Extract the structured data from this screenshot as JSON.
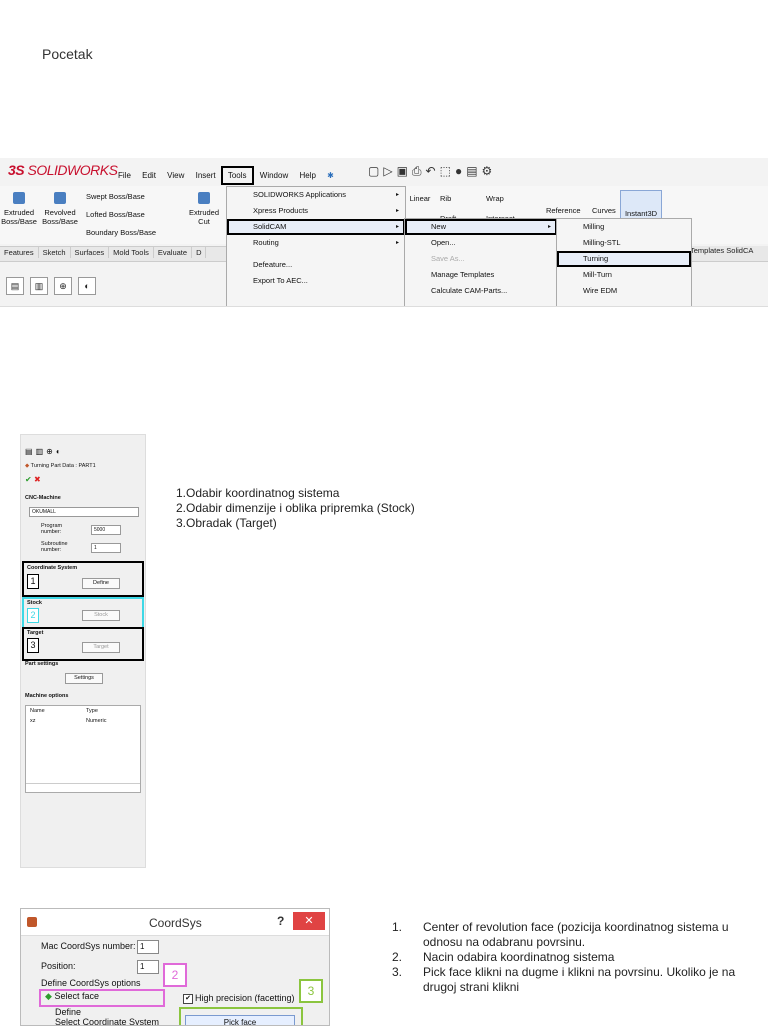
{
  "page_title": "Pocetak",
  "solidworks": {
    "logo": "SOLIDWORKS",
    "menubar": [
      "File",
      "Edit",
      "View",
      "Insert",
      "Tools",
      "Window",
      "Help"
    ],
    "ribbon": {
      "extruded": "Extruded Boss/Base",
      "revolved": "Revolved Boss/Base",
      "swept": "Swept Boss/Base",
      "lofted": "Lofted Boss/Base",
      "boundary": "Boundary Boss/Base",
      "extruded_cut": "Extruded Cut",
      "linear": "Linear",
      "rib": "Rib",
      "draft": "Draft",
      "wrap": "Wrap",
      "intersect": "Intersect",
      "reference": "Reference",
      "curves": "Curves",
      "instant3d": "Instant3D"
    },
    "tabs": [
      "Features",
      "Sketch",
      "Surfaces",
      "Mold Tools",
      "Evaluate",
      "D"
    ],
    "right_tabs": "Templates  SolidCA",
    "tools_menu": [
      {
        "label": "SOLIDWORKS Applications",
        "arrow": "▸"
      },
      {
        "label": "Xpress Products",
        "arrow": "▸"
      },
      {
        "label": "SolidCAM",
        "arrow": "▸"
      },
      {
        "label": "Routing",
        "arrow": "▸"
      },
      {
        "label": "Defeature...",
        "arrow": ""
      },
      {
        "label": "Export To AEC...",
        "arrow": ""
      }
    ],
    "solidcam_menu": [
      {
        "label": "New",
        "arrow": "▸"
      },
      {
        "label": "Open...",
        "arrow": ""
      },
      {
        "label": "Save As...",
        "arrow": ""
      },
      {
        "label": "Manage Templates",
        "arrow": ""
      },
      {
        "label": "Calculate CAM-Parts...",
        "arrow": ""
      }
    ],
    "new_menu": [
      "Milling",
      "Milling-STL",
      "Turning",
      "Mill-Turn",
      "Wire EDM"
    ]
  },
  "turning_panel": {
    "title": "Turning Part Data : PART1",
    "cnc_machine_label": "CNC-Machine",
    "cnc_machine_value": "OKUMALL",
    "program_number_label": "Program number:",
    "program_number_value": "5000",
    "subroutine_number_label": "Subroutine number:",
    "subroutine_number_value": "1",
    "coordinate_system_label": "Coordinate System",
    "define_button": "Define",
    "stock_label": "Stock",
    "stock_button": "Stock",
    "target_label": "Target",
    "target_button": "Target",
    "part_settings_label": "Part settings",
    "settings_button": "Settings",
    "machine_options_label": "Machine options",
    "table_headers": [
      "Name",
      "Type"
    ],
    "table_row": [
      "xz",
      "Numeric"
    ],
    "markers": [
      "1",
      "2",
      "3"
    ]
  },
  "list1": [
    "1.Odabir koordinatnog sistema",
    "2.Odabir dimenzije i oblika pripremka (Stock)",
    "3.Obradak (Target)"
  ],
  "coordsys_dialog": {
    "title": "CoordSys",
    "help": "?",
    "close": "✕",
    "mac_coordsys_label": "Mac CoordSys number:",
    "mac_coordsys_value": "1",
    "position_label": "Position:",
    "position_value": "1",
    "define_options_label": "Define CoordSys options",
    "select_face": "Select face",
    "define": "Define",
    "select_coordinate_system": "Select Coordinate System",
    "high_precision": "High precision (facetting)",
    "pick_face": "Pick face",
    "marker_2": "2",
    "marker_3": "3"
  },
  "list2": [
    {
      "n": "1.",
      "text": "Center of revolution face (pozicija koordinatnog sistema u odnosu na odabranu povrsinu."
    },
    {
      "n": "2.",
      "text": "Nacin odabira koordinatnog sistema"
    },
    {
      "n": "3.",
      "text": "Pick face klikni na dugme i klikni na povrsinu. Ukoliko je na drugoj strani klikni"
    }
  ]
}
